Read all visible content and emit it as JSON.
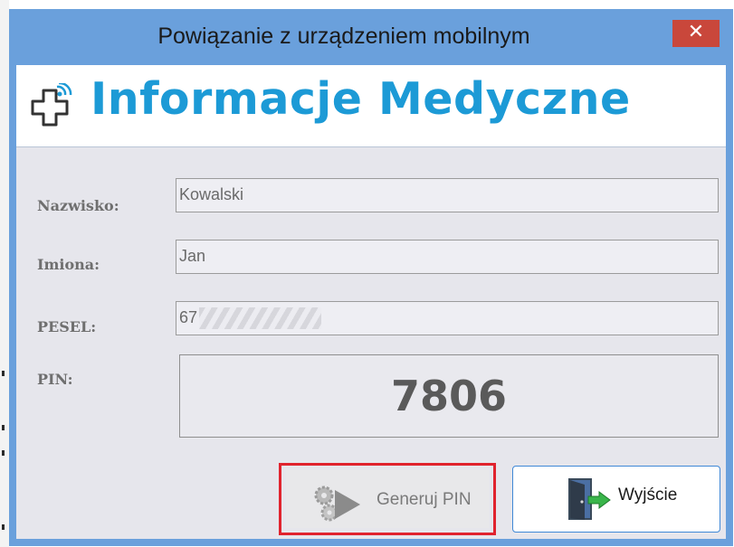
{
  "window": {
    "title": "Powiązanie z urządzeniem mobilnym",
    "close_glyph": "✕"
  },
  "banner": {
    "title": "Informacje Medyczne",
    "icon": "medical-cross-icon",
    "accent_color": "#1c9ad6"
  },
  "form": {
    "surname": {
      "label": "Nazwisko:",
      "value": "Kowalski"
    },
    "first_names": {
      "label": "Imiona:",
      "value": "Jan"
    },
    "pesel": {
      "label": "PESEL:",
      "value": "67"
    },
    "pin": {
      "label": "PIN:",
      "value": "7806"
    }
  },
  "buttons": {
    "generate": {
      "label": "Generuj PIN",
      "icon": "play-gears-icon",
      "highlight_color": "#e0232e"
    },
    "exit": {
      "label": "Wyjście",
      "icon": "exit-door-icon"
    }
  }
}
